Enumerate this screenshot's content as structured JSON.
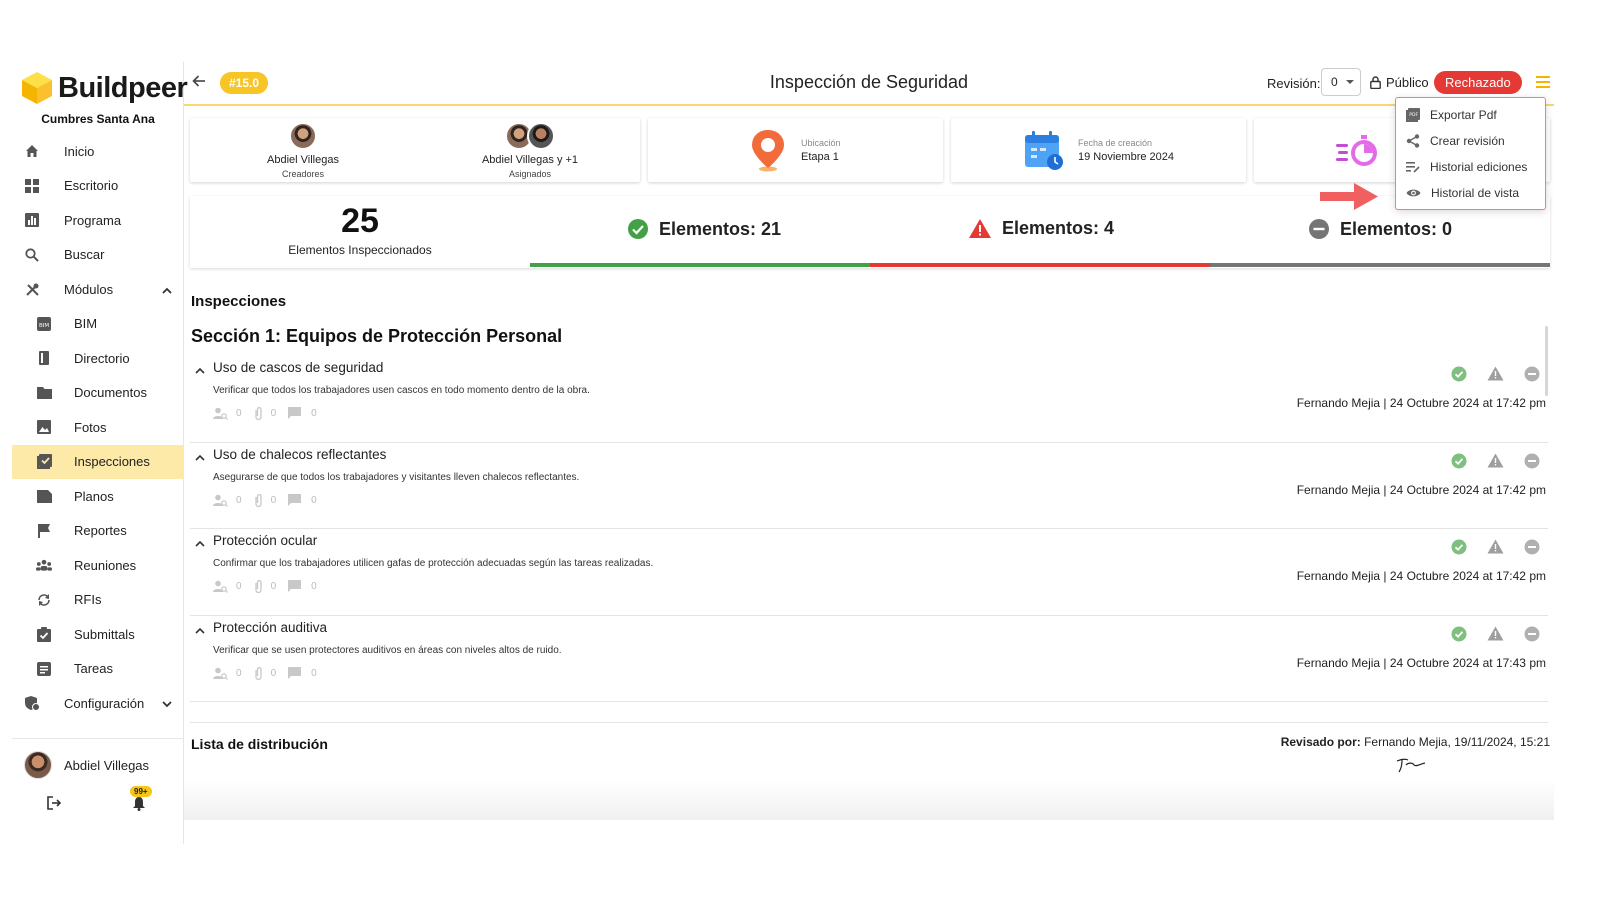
{
  "app": {
    "name": "Buildpeer",
    "project": "Cumbres Santa Ana"
  },
  "sidebar": {
    "items": [
      {
        "label": "Inicio",
        "icon": "home-icon"
      },
      {
        "label": "Escritorio",
        "icon": "dashboard-icon"
      },
      {
        "label": "Programa",
        "icon": "chart-icon"
      },
      {
        "label": "Buscar",
        "icon": "search-icon"
      },
      {
        "label": "Módulos",
        "icon": "tools-icon"
      }
    ],
    "modules": [
      {
        "label": "BIM",
        "icon": "bim-icon"
      },
      {
        "label": "Directorio",
        "icon": "book-icon"
      },
      {
        "label": "Documentos",
        "icon": "folder-icon"
      },
      {
        "label": "Fotos",
        "icon": "image-icon"
      },
      {
        "label": "Inspecciones",
        "icon": "checklist-icon"
      },
      {
        "label": "Planos",
        "icon": "blueprint-icon"
      },
      {
        "label": "Reportes",
        "icon": "flag-icon"
      },
      {
        "label": "Reuniones",
        "icon": "group-icon"
      },
      {
        "label": "RFIs",
        "icon": "sync-icon"
      },
      {
        "label": "Submittals",
        "icon": "clipboard-check-icon"
      },
      {
        "label": "Tareas",
        "icon": "task-icon"
      }
    ],
    "config": "Configuración",
    "user": "Abdiel Villegas",
    "notifications": "99+"
  },
  "header": {
    "version": "#15.0",
    "title": "Inspección de Seguridad",
    "revision_label": "Revisión:",
    "revision_value": "0",
    "visibility": "Público",
    "status": "Rechazado"
  },
  "cards": {
    "creator_name": "Abdiel Villegas",
    "creator_role": "Creadores",
    "assigned_name": "Abdiel Villegas y +1",
    "assigned_role": "Asignados",
    "location_label": "Ubicación",
    "location_value": "Etapa 1",
    "date_label": "Fecha de creación",
    "date_value": "19 Noviembre 2024"
  },
  "stats": {
    "total": "25",
    "total_label": "Elementos Inspeccionados",
    "ok": "Elementos: 21",
    "warn": "Elementos: 4",
    "na": "Elementos: 0",
    "colors": {
      "ok": "#43a047",
      "warn": "#e53935",
      "na": "#757575"
    }
  },
  "inspections": {
    "title": "Inspecciones",
    "section": "Sección 1: Equipos de Protección Personal",
    "items": [
      {
        "title": "Uso de cascos de seguridad",
        "desc": "Verificar que todos los trabajadores usen cascos en todo momento dentro de la obra.",
        "users": "0",
        "files": "0",
        "comments": "0",
        "by": "Fernando Mejia | 24 Octubre 2024 at 17:42 pm"
      },
      {
        "title": "Uso de chalecos reflectantes",
        "desc": "Asegurarse de que todos los trabajadores y visitantes lleven chalecos reflectantes.",
        "users": "0",
        "files": "0",
        "comments": "0",
        "by": "Fernando Mejia | 24 Octubre 2024 at 17:42 pm"
      },
      {
        "title": "Protección ocular",
        "desc": "Confirmar que los trabajadores utilicen gafas de protección adecuadas según las tareas realizadas.",
        "users": "0",
        "files": "0",
        "comments": "0",
        "by": "Fernando Mejia | 24 Octubre 2024 at 17:42 pm"
      },
      {
        "title": "Protección auditiva",
        "desc": "Verificar que se usen protectores auditivos en áreas con niveles altos de ruido.",
        "users": "0",
        "files": "0",
        "comments": "0",
        "by": "Fernando Mejia | 24 Octubre 2024 at 17:43 pm"
      }
    ]
  },
  "distribution": {
    "title": "Lista de distribución",
    "reviewed_label": "Revisado por:",
    "reviewed_value": "Fernando Mejia, 19/11/2024, 15:21"
  },
  "menu": {
    "items": [
      {
        "label": "Exportar Pdf",
        "icon": "pdf-icon"
      },
      {
        "label": "Crear revisión",
        "icon": "share-icon"
      },
      {
        "label": "Historial ediciones",
        "icon": "edit-list-icon"
      },
      {
        "label": "Historial de vista",
        "icon": "eye-icon"
      }
    ]
  }
}
